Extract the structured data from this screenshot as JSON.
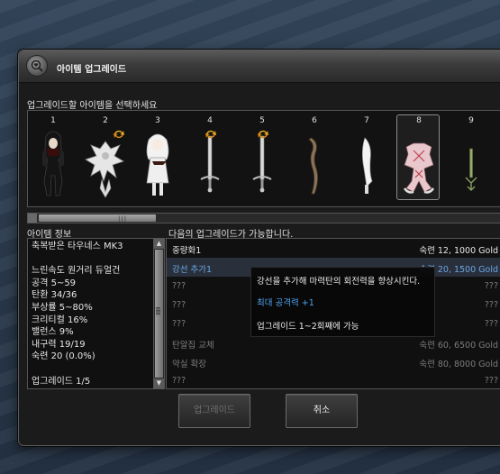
{
  "window": {
    "title": "아이템 업그레이드",
    "icon": "magnifier-heart-icon"
  },
  "items_section": {
    "instruction": "업그레이드할 아이템을 선택하세요",
    "selected_index": 8,
    "slots": [
      {
        "number": "1",
        "icon": "dark-hooded-costume-icon",
        "upgrade_badge": false
      },
      {
        "number": "2",
        "icon": "white-spiked-creature-icon",
        "upgrade_badge": true
      },
      {
        "number": "3",
        "icon": "white-dress-character-icon",
        "upgrade_badge": false
      },
      {
        "number": "4",
        "icon": "silver-sword-icon",
        "upgrade_badge": true
      },
      {
        "number": "5",
        "icon": "silver-sword-icon",
        "upgrade_badge": true
      },
      {
        "number": "6",
        "icon": "wooden-staff-icon",
        "upgrade_badge": false
      },
      {
        "number": "7",
        "icon": "white-blade-icon",
        "upgrade_badge": false
      },
      {
        "number": "8",
        "icon": "pink-armor-icon",
        "upgrade_badge": false
      },
      {
        "number": "9",
        "icon": "green-wand-icon",
        "upgrade_badge": false
      }
    ]
  },
  "info": {
    "label": "아이템 정보",
    "lines": [
      "축복받은 타우네스 MK3",
      "",
      "느린속도 원거리 듀얼건",
      "공격 5~59",
      "탄환 34/36",
      "부상률 5~80%",
      "크리티컬 16%",
      "밸런스 9%",
      "내구력 19/19",
      "숙련 20 (0.0%)",
      "",
      "업그레이드 1/5"
    ]
  },
  "upgrades": {
    "label": "다음의 업그레이드가 가능합니다.",
    "rows": [
      {
        "name": "중량화1",
        "cost": "숙련 12, 1000 Gold",
        "state": "available"
      },
      {
        "name": "강선 추가1",
        "cost": "숙련 20, 1500 Gold",
        "state": "highlighted"
      },
      {
        "name": "???",
        "cost": "???",
        "state": "locked"
      },
      {
        "name": "???",
        "cost": "???",
        "state": "locked"
      },
      {
        "name": "???",
        "cost": "???",
        "state": "locked"
      },
      {
        "name": "탄알집 교체",
        "cost": "숙련 60, 6500 Gold",
        "state": "locked"
      },
      {
        "name": "약실 확장",
        "cost": "숙련 80, 8000 Gold",
        "state": "locked"
      },
      {
        "name": "???",
        "cost": "???",
        "state": "locked"
      }
    ]
  },
  "tooltip": {
    "description": "강선을 추가해 마력탄의 회전력을 향상시킨다.",
    "effect": "최대 공격력 +1",
    "condition": "업그레이드 1~2회째에 가능"
  },
  "buttons": {
    "upgrade": "업그레이드",
    "cancel": "취소"
  },
  "colors": {
    "highlight_blue": "#6aa6e6",
    "effect_blue": "#4fa3ef",
    "disabled_gray": "#7c7c7c",
    "window_bg": "#1b1b1b"
  }
}
